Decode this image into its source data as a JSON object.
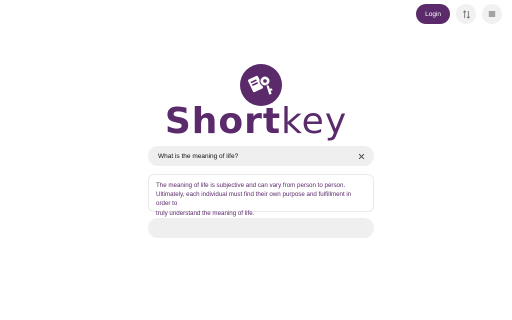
{
  "header": {
    "login_label": "Login",
    "sort_icon": "sort-icon",
    "menu_icon": "menu-icon"
  },
  "brand": {
    "logo_icon": "key-card-icon",
    "name_part1": "Short",
    "name_part2": "key",
    "color": "#5a2a6a"
  },
  "search": {
    "value": "What is the meaning of life?",
    "placeholder": ""
  },
  "answer": {
    "line1": "The meaning of life is subjective and can vary from person to person.",
    "line2": "Ultimately, each individual must find their own purpose and fulfillment in order to",
    "line3": "truly understand the meaning of life."
  },
  "followup": {
    "placeholder": ""
  }
}
